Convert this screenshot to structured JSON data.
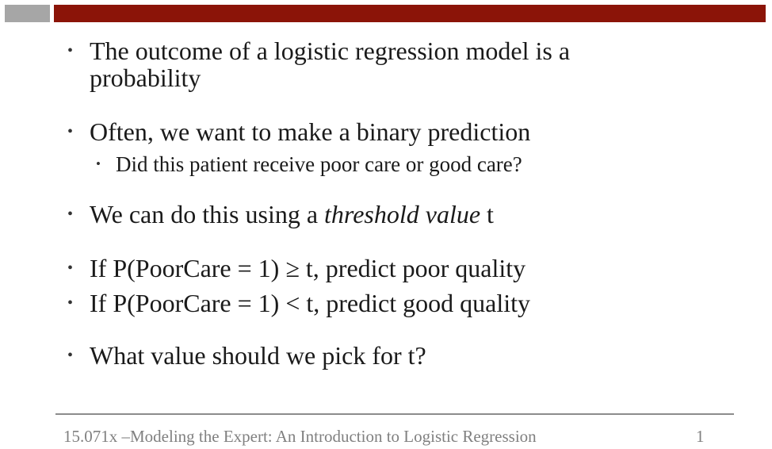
{
  "slide": {
    "bullets": [
      {
        "line1": "The outcome of a logistic regression model is a",
        "line2": "probability"
      },
      {
        "text": "Often, we want to make a binary prediction"
      },
      {
        "text": "Did this patient receive poor care or good care?"
      },
      {
        "before": "We can do this using a ",
        "italic": "threshold value",
        "after": " t"
      },
      {
        "text": "If P(PoorCare = 1) ≥ t, predict poor quality"
      },
      {
        "text": "If P(PoorCare = 1) < t, predict good quality"
      },
      {
        "text": "What value should we pick for t?"
      }
    ],
    "bullet_symbol": "•"
  },
  "footer": {
    "text": "15.071x –Modeling the Expert: An Introduction to Logistic Regression",
    "page_number": "1"
  },
  "colors": {
    "header_bar": "#8b1408",
    "header_block": "#a6a6a6",
    "footer_text": "#808080"
  }
}
